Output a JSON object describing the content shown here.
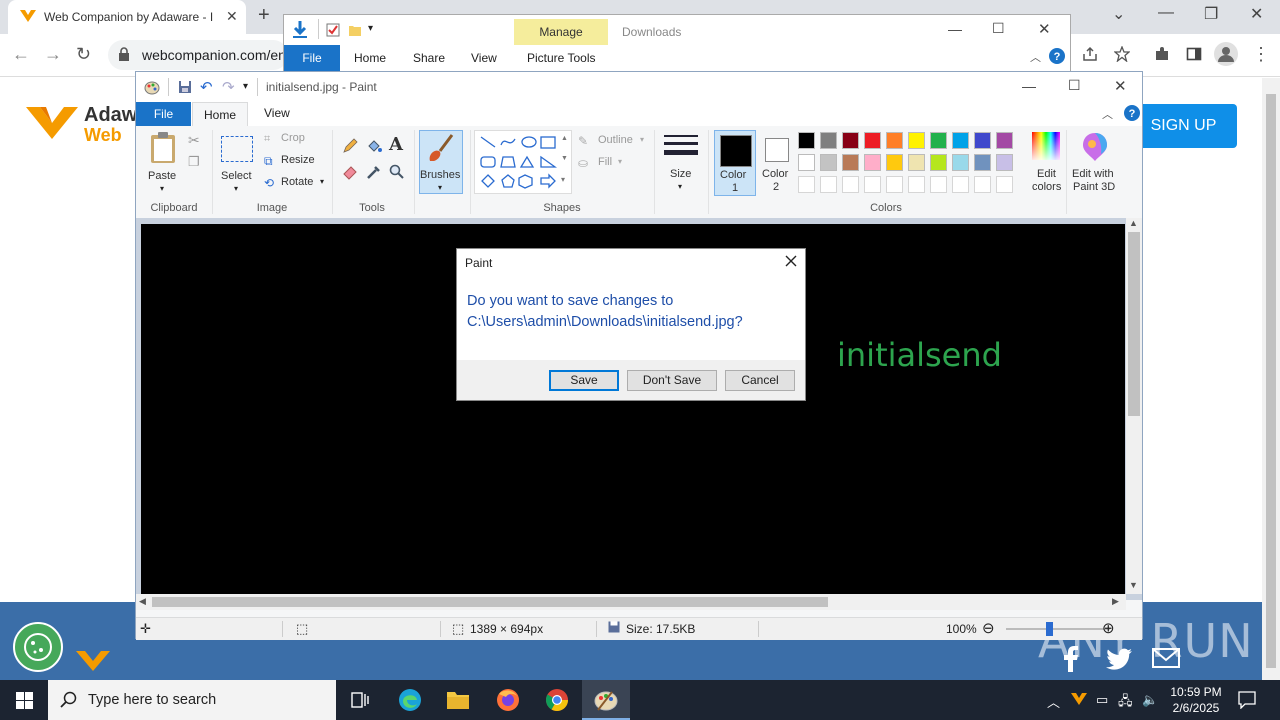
{
  "chrome": {
    "tab_title": "Web Companion by Adaware - I",
    "url": "webcompanion.com/en"
  },
  "website": {
    "brand_line1": "Adaw",
    "brand_line2": "Web",
    "signup_label": "SIGN UP",
    "watermark": "ANY RUN"
  },
  "explorer": {
    "manage_label": "Manage",
    "title": "Downloads",
    "tabs": [
      "File",
      "Home",
      "Share",
      "View",
      "Picture Tools"
    ]
  },
  "paint": {
    "title": "initialsend.jpg - Paint",
    "tabs": [
      "File",
      "Home",
      "View"
    ],
    "ribbon": {
      "clipboard": {
        "paste": "Paste",
        "group": "Clipboard"
      },
      "image": {
        "select": "Select",
        "crop": "Crop",
        "resize": "Resize",
        "rotate": "Rotate",
        "group": "Image"
      },
      "tools": {
        "group": "Tools"
      },
      "brushes": "Brushes",
      "shapes": {
        "outline": "Outline",
        "fill": "Fill",
        "group": "Shapes"
      },
      "size": "Size",
      "color1": [
        "Color",
        "1"
      ],
      "color2": [
        "Color",
        "2"
      ],
      "colors_group": "Colors",
      "edit_colors": [
        "Edit",
        "colors"
      ],
      "paint3d": [
        "Edit with",
        "Paint 3D"
      ]
    },
    "palette_row1": [
      "#000000",
      "#7f7f7f",
      "#880015",
      "#ed1c24",
      "#ff7f27",
      "#fff200",
      "#22b14c",
      "#00a2e8",
      "#3f48cc",
      "#a349a4"
    ],
    "palette_row2": [
      "#ffffff",
      "#c3c3c3",
      "#b97a57",
      "#ffaec9",
      "#ffc90e",
      "#efe4b0",
      "#b5e61d",
      "#99d9ea",
      "#7092be",
      "#c8bfe7"
    ],
    "color1_value": "#000000",
    "color2_value": "#ffffff",
    "canvas_text": "initialsend",
    "status": {
      "dimensions": "1389 × 694px",
      "size": "Size: 17.5KB",
      "zoom": "100%"
    }
  },
  "dialog": {
    "title": "Paint",
    "message_line1": "Do you want to save changes to",
    "message_line2": "C:\\Users\\admin\\Downloads\\initialsend.jpg?",
    "save": "Save",
    "dont_save": "Don't Save",
    "cancel": "Cancel"
  },
  "taskbar": {
    "search_placeholder": "Type here to search",
    "time": "10:59 PM",
    "date": "2/6/2025"
  }
}
